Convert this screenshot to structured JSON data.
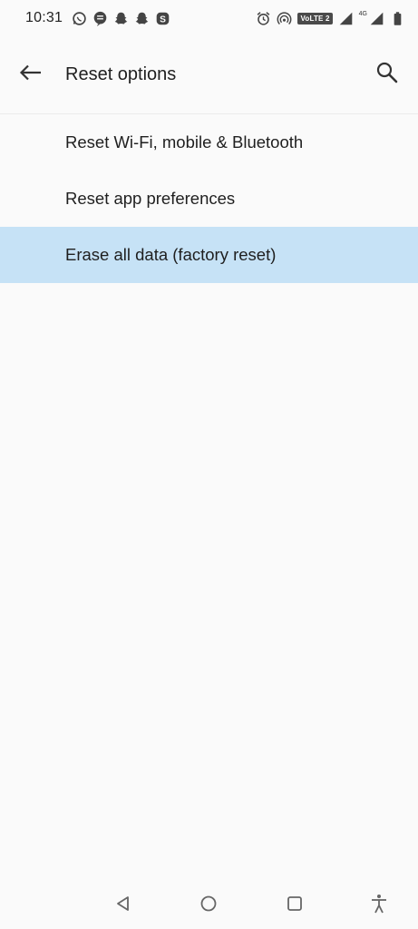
{
  "status_bar": {
    "time": "10:31",
    "notification_icons": [
      "whatsapp-icon",
      "messaging-icon",
      "snapchat-icon",
      "snapchat-icon",
      "skype-icon"
    ],
    "volte_label": "VoLTE 2",
    "network_type": "4G",
    "system_icons": [
      "alarm-icon",
      "hotspot-icon",
      "signal-icon",
      "signal-icon",
      "battery-icon"
    ]
  },
  "app_bar": {
    "title": "Reset options",
    "back_icon": "arrow-left-icon",
    "search_icon": "search-icon"
  },
  "options": [
    {
      "label": "Reset Wi-Fi, mobile & Bluetooth",
      "selected": false
    },
    {
      "label": "Reset app preferences",
      "selected": false
    },
    {
      "label": "Erase all data (factory reset)",
      "selected": true
    }
  ],
  "colors": {
    "background": "#fafafa",
    "selected_row": "#c6e2f6",
    "text": "#1f1f1f",
    "icon": "#555555"
  },
  "nav_bar": {
    "buttons": [
      "back-triangle-icon",
      "home-circle-icon",
      "recents-square-icon",
      "accessibility-icon"
    ]
  }
}
